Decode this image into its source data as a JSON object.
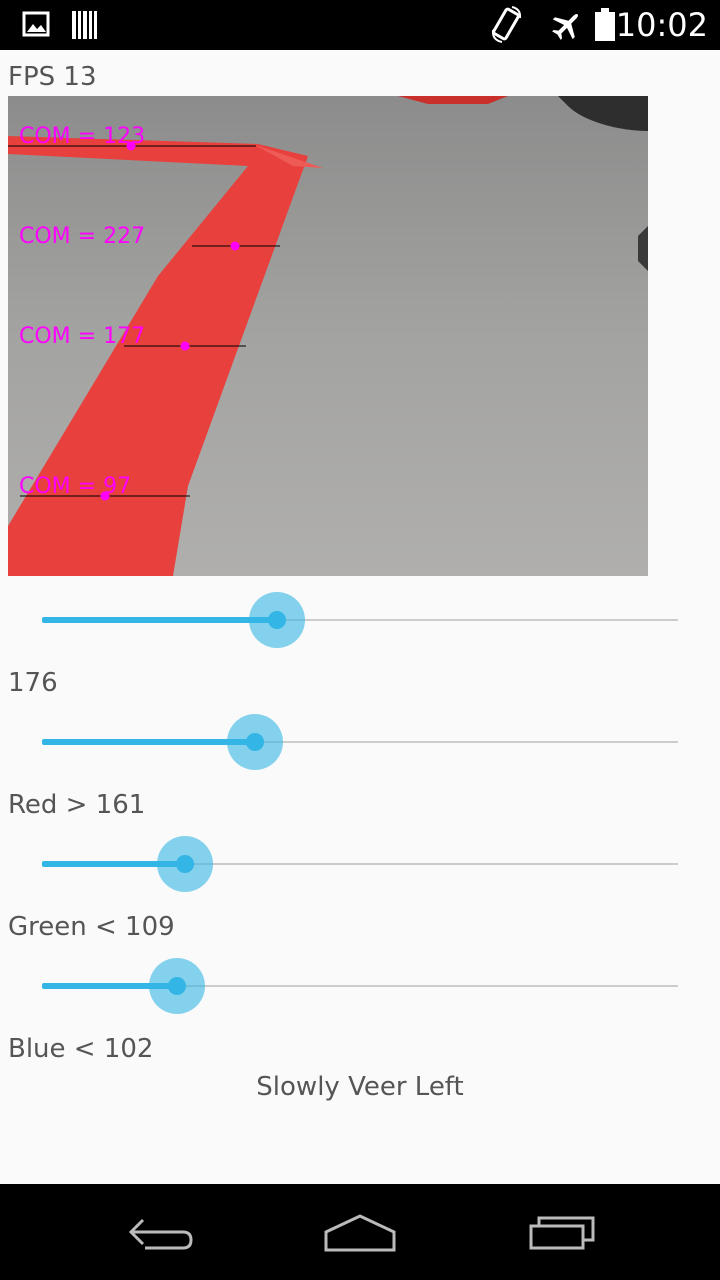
{
  "status_bar": {
    "time": "10:02",
    "icons": [
      "image-icon",
      "barcode-icon",
      "rotate-phone-icon",
      "airplane-icon",
      "battery-icon"
    ]
  },
  "fps_label": "FPS 13",
  "camera": {
    "com_labels": [
      "COM = 123",
      "COM = 227",
      "COM = 177",
      "COM = 97"
    ],
    "tape_color": "#e8403d",
    "marker_color": "#ff00ff"
  },
  "sliders": [
    {
      "name": "threshold-slider",
      "fraction": 0.37
    },
    {
      "name": "red-slider",
      "fraction": 0.335
    },
    {
      "name": "green-slider",
      "fraction": 0.225
    },
    {
      "name": "blue-slider",
      "fraction": 0.213
    }
  ],
  "labels": {
    "threshold": "176",
    "red": "Red > 161",
    "green": "Green < 109",
    "blue": "Blue < 102"
  },
  "status_text": "Slowly Veer Left",
  "accent_color": "#33b5e5"
}
